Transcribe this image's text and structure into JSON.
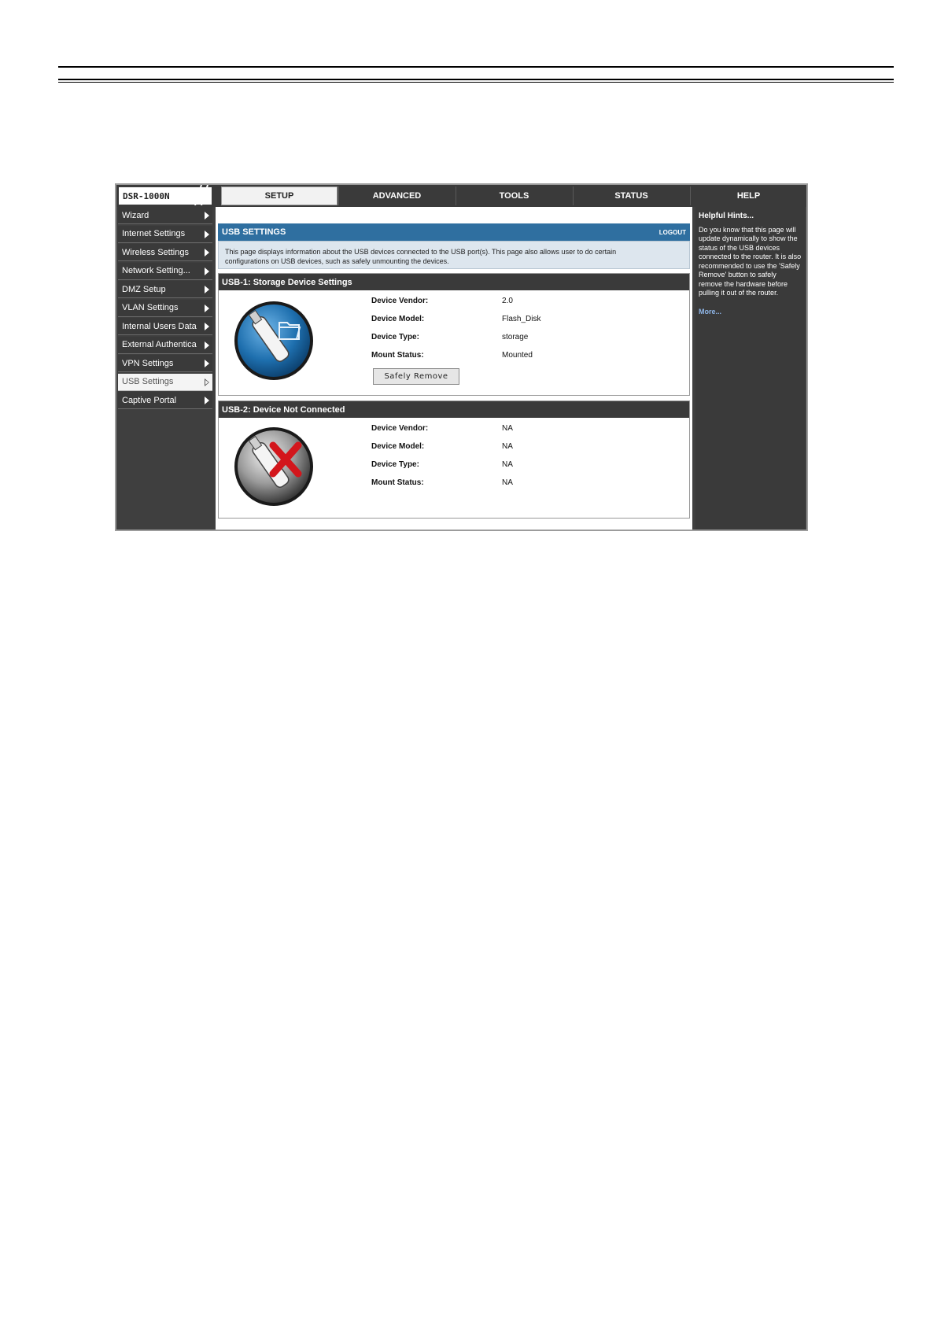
{
  "app": {
    "model": "DSR-1000N",
    "tabs": [
      {
        "label": "SETUP",
        "active": true
      },
      {
        "label": "ADVANCED",
        "active": false
      },
      {
        "label": "TOOLS",
        "active": false
      },
      {
        "label": "STATUS",
        "active": false
      },
      {
        "label": "HELP",
        "active": false
      }
    ]
  },
  "sidebar": {
    "items": [
      {
        "label": "Wizard"
      },
      {
        "label": "Internet Settings"
      },
      {
        "label": "Wireless Settings"
      },
      {
        "label": "Network Setting..."
      },
      {
        "label": "DMZ Setup"
      },
      {
        "label": "VLAN Settings"
      },
      {
        "label": "Internal Users Data"
      },
      {
        "label": "External Authentica"
      },
      {
        "label": "VPN Settings"
      },
      {
        "label": "USB Settings"
      },
      {
        "label": "Captive Portal"
      }
    ],
    "active_index": 9
  },
  "panel": {
    "title": "USB SETTINGS",
    "logout": "LOGOUT",
    "description_line1": "This page displays information about the USB devices connected to the USB port(s). This page also allows user to do certain",
    "description_line2": "configurations on USB devices, such as safely unmounting the devices."
  },
  "usb1": {
    "title": "USB-1: Storage Device Settings",
    "fields": [
      {
        "label": "Device Vendor:",
        "value": "2.0"
      },
      {
        "label": "Device Model:",
        "value": "Flash_Disk"
      },
      {
        "label": "Device Type:",
        "value": "storage"
      },
      {
        "label": "Mount Status:",
        "value": "Mounted"
      }
    ],
    "button": "Safely Remove",
    "icon": "usb-storage-icon"
  },
  "usb2": {
    "title": "USB-2: Device Not Connected",
    "fields": [
      {
        "label": "Device Vendor:",
        "value": "NA"
      },
      {
        "label": "Device Model:",
        "value": "NA"
      },
      {
        "label": "Device Type:",
        "value": "NA"
      },
      {
        "label": "Mount Status:",
        "value": "NA"
      }
    ],
    "icon": "usb-disconnected-icon"
  },
  "help": {
    "title": "Helpful Hints...",
    "text": "Do you know that this page will update dynamically to show the status of the USB devices connected to the router. It is also recommended to use the 'Safely Remove' button to safely remove the hardware before pulling it out of the router.",
    "more": "More..."
  },
  "colors": {
    "panel_header": "#2f6fa0",
    "dark_bg": "#3a3a3a",
    "help_link": "#8fb6e8"
  }
}
